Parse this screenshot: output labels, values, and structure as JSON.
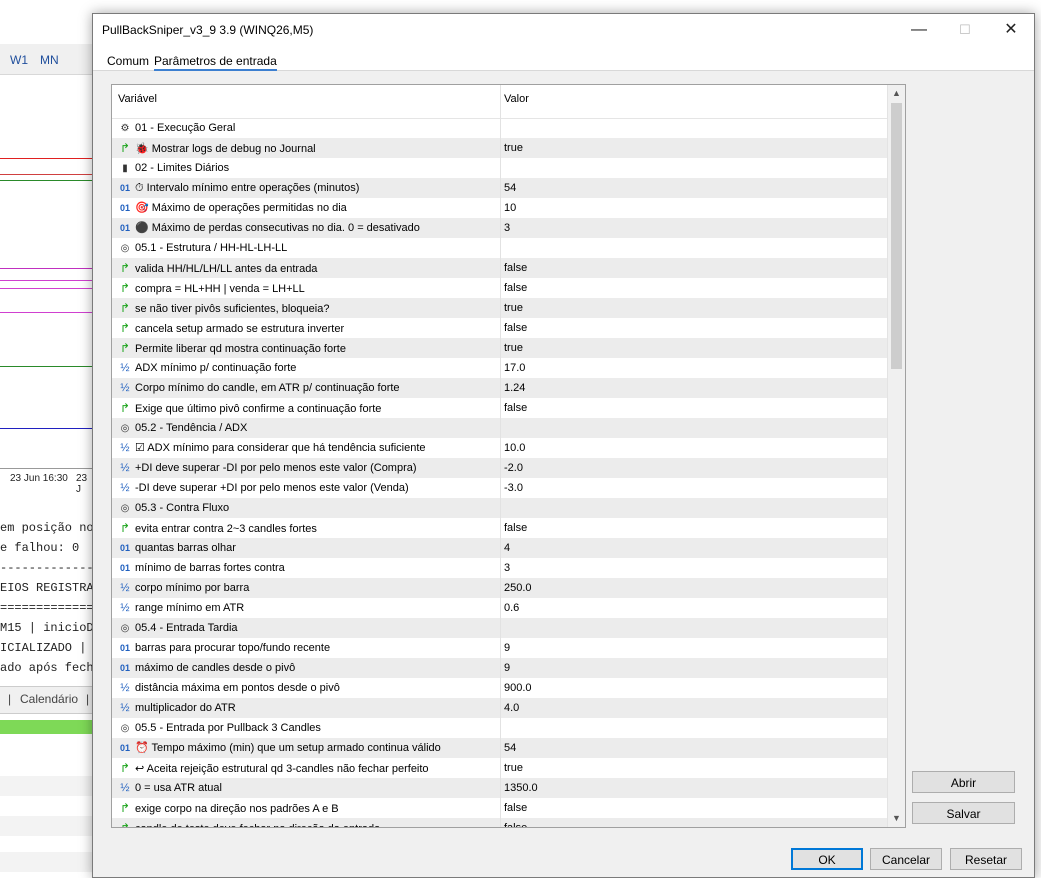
{
  "background": {
    "toolbar": [
      "W1",
      "MN"
    ],
    "axis_labels": [
      "23 Jun 16:30",
      "23 J"
    ],
    "journal_lines": [
      "em posição no",
      "e falhou: 0",
      "--------------",
      "EIOS REGISTRA",
      "==============",
      "M15 | inicioD",
      "ICIALIZADO | i",
      "ado após fecha"
    ],
    "tab_calendar": "Calendário"
  },
  "dialog": {
    "title": "PullBackSniper_v3_9 3.9 (WINQ26,M5)",
    "controls": {
      "minimize": "—",
      "maximize": "☐",
      "close": "✕"
    },
    "tabs": [
      {
        "label": "Comum",
        "active": false
      },
      {
        "label": "Parâmetros de entrada",
        "active": true
      }
    ],
    "columns": {
      "variable": "Variável",
      "value": "Valor"
    },
    "rows": [
      {
        "icon": "gear-icon",
        "type": "group",
        "glyph": "⚙",
        "label": "01 - Execução Geral",
        "value": ""
      },
      {
        "icon": "bool-icon",
        "type": "bool",
        "glyph": "↱",
        "label": "🐞 Mostrar logs de debug no Journal",
        "value": "true"
      },
      {
        "icon": "lock-icon",
        "type": "group",
        "glyph": "▮",
        "label": "02 - Limites Diários",
        "value": ""
      },
      {
        "icon": "int-icon",
        "type": "int",
        "glyph": "01",
        "label": "⏱ Intervalo mínimo entre operações (minutos)",
        "value": "54"
      },
      {
        "icon": "int-icon",
        "type": "int",
        "glyph": "01",
        "label": "🎯 Máximo de operações permitidas no dia",
        "value": "10"
      },
      {
        "icon": "int-icon",
        "type": "int",
        "glyph": "01",
        "label": "⚫ Máximo de perdas consecutivas no dia. 0 = desativado",
        "value": "3"
      },
      {
        "icon": "target-icon",
        "type": "group",
        "glyph": "◎",
        "label": "05.1 - Estrutura / HH-HL-LH-LL",
        "value": ""
      },
      {
        "icon": "bool-icon",
        "type": "bool",
        "glyph": "↱",
        "label": "valida HH/HL/LH/LL antes da entrada",
        "value": "false"
      },
      {
        "icon": "bool-icon",
        "type": "bool",
        "glyph": "↱",
        "label": "compra = HL+HH | venda = LH+LL",
        "value": "false"
      },
      {
        "icon": "bool-icon",
        "type": "bool",
        "glyph": "↱",
        "label": "se não tiver pivôs suficientes, bloqueia?",
        "value": "true"
      },
      {
        "icon": "bool-icon",
        "type": "bool",
        "glyph": "↱",
        "label": "cancela setup armado se estrutura inverter",
        "value": "false"
      },
      {
        "icon": "bool-icon",
        "type": "bool",
        "glyph": "↱",
        "label": "Permite liberar qd mostra continuação forte",
        "value": "true"
      },
      {
        "icon": "double-icon",
        "type": "double",
        "glyph": "½",
        "label": "ADX mínimo p/ continuação forte",
        "value": "17.0"
      },
      {
        "icon": "double-icon",
        "type": "double",
        "glyph": "½",
        "label": "Corpo mínimo do candle, em ATR p/ continuação forte",
        "value": "1.24"
      },
      {
        "icon": "bool-icon",
        "type": "bool",
        "glyph": "↱",
        "label": "Exige que último pivô confirme a continuação forte",
        "value": "false"
      },
      {
        "icon": "target-icon",
        "type": "group",
        "glyph": "◎",
        "label": "05.2 - Tendência / ADX",
        "value": ""
      },
      {
        "icon": "double-icon",
        "type": "double",
        "glyph": "½",
        "label": "☑ ADX mínimo para considerar que há tendência suficiente",
        "value": "10.0"
      },
      {
        "icon": "double-icon",
        "type": "double",
        "glyph": "½",
        "label": "+DI deve superar -DI por pelo menos este valor (Compra)",
        "value": "-2.0"
      },
      {
        "icon": "double-icon",
        "type": "double",
        "glyph": "½",
        "label": "-DI deve superar +DI por pelo menos este valor (Venda)",
        "value": "-3.0"
      },
      {
        "icon": "target-icon",
        "type": "group",
        "glyph": "◎",
        "label": "05.3 - Contra Fluxo",
        "value": ""
      },
      {
        "icon": "bool-icon",
        "type": "bool",
        "glyph": "↱",
        "label": "evita entrar contra 2~3 candles fortes",
        "value": "false"
      },
      {
        "icon": "int-icon",
        "type": "int",
        "glyph": "01",
        "label": "quantas barras olhar",
        "value": "4"
      },
      {
        "icon": "int-icon",
        "type": "int",
        "glyph": "01",
        "label": "mínimo de barras fortes contra",
        "value": "3"
      },
      {
        "icon": "double-icon",
        "type": "double",
        "glyph": "½",
        "label": "corpo mínimo por barra",
        "value": "250.0"
      },
      {
        "icon": "double-icon",
        "type": "double",
        "glyph": "½",
        "label": "range mínimo em ATR",
        "value": "0.6"
      },
      {
        "icon": "target-icon",
        "type": "group",
        "glyph": "◎",
        "label": "05.4 - Entrada Tardia",
        "value": ""
      },
      {
        "icon": "int-icon",
        "type": "int",
        "glyph": "01",
        "label": "barras para procurar topo/fundo recente",
        "value": "9"
      },
      {
        "icon": "int-icon",
        "type": "int",
        "glyph": "01",
        "label": "máximo de candles desde o pivô",
        "value": "9"
      },
      {
        "icon": "double-icon",
        "type": "double",
        "glyph": "½",
        "label": "distância máxima em pontos desde o pivô",
        "value": "900.0"
      },
      {
        "icon": "double-icon",
        "type": "double",
        "glyph": "½",
        "label": "multiplicador do ATR",
        "value": "4.0"
      },
      {
        "icon": "target-icon",
        "type": "group",
        "glyph": "◎",
        "label": "05.5 - Entrada por Pullback 3 Candles",
        "value": ""
      },
      {
        "icon": "int-icon",
        "type": "int",
        "glyph": "01",
        "label": "⏰ Tempo máximo (min) que um setup armado continua válido",
        "value": "54"
      },
      {
        "icon": "bool-icon",
        "type": "bool",
        "glyph": "↱",
        "label": "↩ Aceita rejeição estrutural qd 3-candles não fechar perfeito",
        "value": "true"
      },
      {
        "icon": "double-icon",
        "type": "double",
        "glyph": "½",
        "label": "0 = usa ATR atual",
        "value": "1350.0"
      },
      {
        "icon": "bool-icon",
        "type": "bool",
        "glyph": "↱",
        "label": "exige corpo na direção nos padrões A e B",
        "value": "false"
      },
      {
        "icon": "bool-icon",
        "type": "bool",
        "glyph": "↱",
        "label": "candle de teste deve fechar na direção da entrada",
        "value": "false"
      }
    ],
    "buttons": {
      "open": "Abrir",
      "save": "Salvar",
      "ok": "OK",
      "cancel": "Cancelar",
      "reset": "Resetar"
    }
  }
}
